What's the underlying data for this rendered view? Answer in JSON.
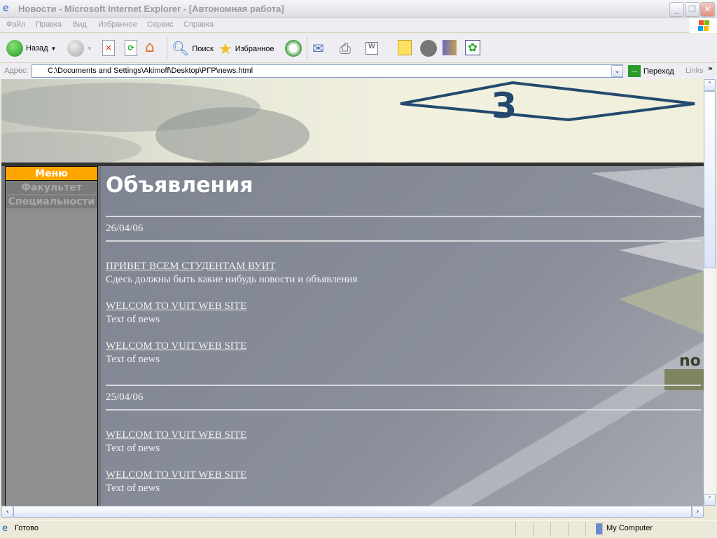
{
  "window": {
    "title": "Новости - Microsoft Internet Explorer - [Автономная работа]"
  },
  "menu": [
    "Файл",
    "Правка",
    "Вид",
    "Избранное",
    "Сервис",
    "Справка"
  ],
  "toolbar": {
    "back": "Назад",
    "search": "Поиск",
    "favorites": "Избранное"
  },
  "address": {
    "label": "Адрес:",
    "url": "C:\\Documents and Settings\\Akimoff\\Desktop\\РГР\\news.html",
    "go": "Переход",
    "links": "Links"
  },
  "page": {
    "sidebar": {
      "header": "Меню",
      "items": [
        "Факультет",
        "Специальности"
      ]
    },
    "heading": "Объявления",
    "groups": [
      {
        "date": "26/04/06",
        "items": [
          {
            "title": "ПРИВЕТ ВСЕМ СТУДЕНТАМ ВУИТ",
            "text": "Сдесь должны быть какие нибудь новости и объявления"
          },
          {
            "title": "WELCOM TO VUIT WEB SITE",
            "text": "Text of news"
          },
          {
            "title": "WELCOM TO VUIT WEB SITE",
            "text": "Text of news"
          }
        ]
      },
      {
        "date": "25/04/06",
        "items": [
          {
            "title": "WELCOM TO VUIT WEB SITE",
            "text": "Text of news"
          },
          {
            "title": "WELCOM TO VUIT WEB SITE",
            "text": "Text of news"
          }
        ]
      }
    ]
  },
  "status": {
    "text": "Готово",
    "zone": "My Computer"
  },
  "colors": {
    "menu_header": "#ffa500",
    "content_bg": "#878c98",
    "banner": "#f0efdc"
  }
}
